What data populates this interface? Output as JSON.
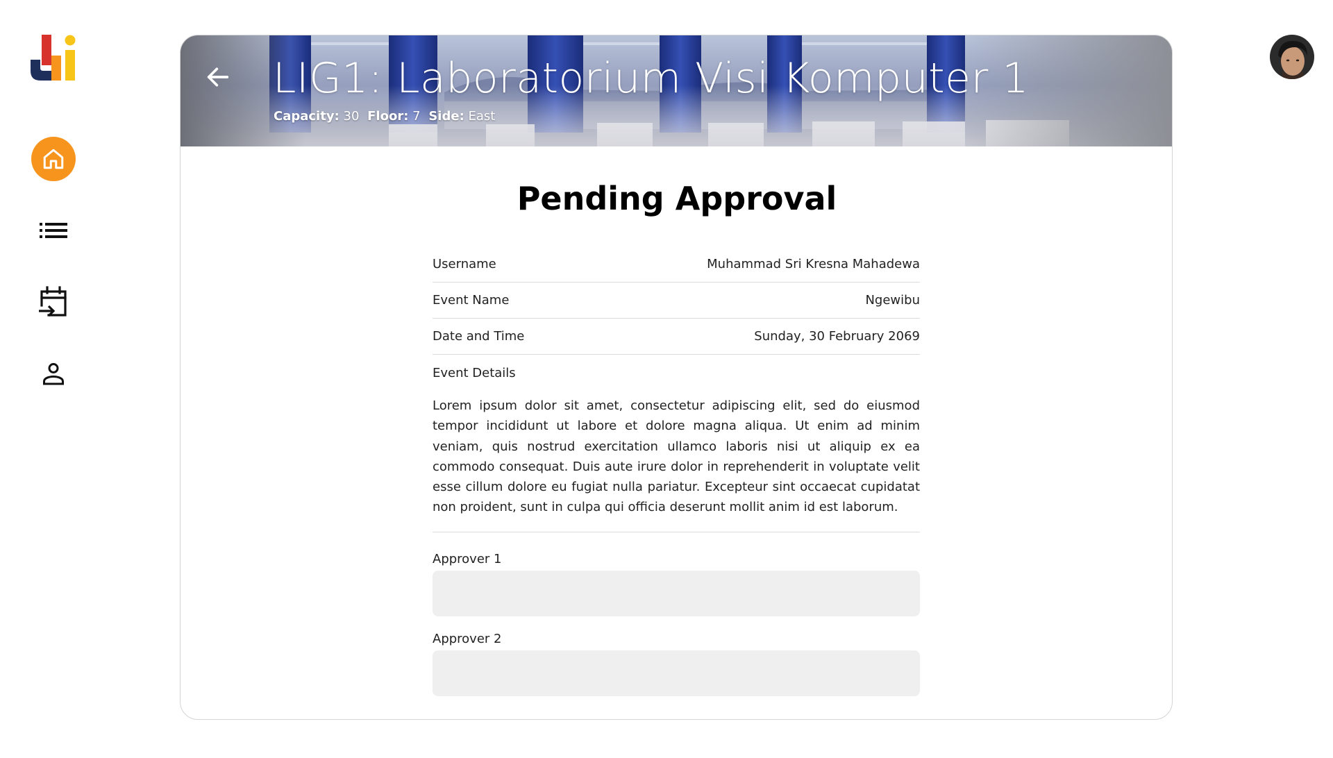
{
  "sidebar": {
    "logo_text": "Ji",
    "items": [
      {
        "name": "home",
        "icon": "home-icon",
        "active": true
      },
      {
        "name": "list",
        "icon": "list-icon",
        "active": false
      },
      {
        "name": "calendar-checkin",
        "icon": "calendar-arrow-icon",
        "active": false
      },
      {
        "name": "profile",
        "icon": "person-icon",
        "active": false
      }
    ]
  },
  "colors": {
    "accent": "#F7941D",
    "brand_blue": "#1F2F5C",
    "brand_red": "#D7322B",
    "brand_yellow": "#F7C518",
    "card_border": "#D4D4D4",
    "field_bg": "#EFEFEF"
  },
  "room": {
    "title": "LIG1: Laboratorium Visi Komputer 1",
    "capacity_label": "Capacity:",
    "capacity_value": "30",
    "floor_label": "Floor:",
    "floor_value": "7",
    "side_label": "Side:",
    "side_value": "East"
  },
  "page": {
    "heading": "Pending Approval"
  },
  "details": {
    "username_label": "Username",
    "username_value": "Muhammad Sri Kresna Mahadewa",
    "event_name_label": "Event Name",
    "event_name_value": "Ngewibu",
    "datetime_label": "Date and Time",
    "datetime_value": "Sunday, 30 February 2069",
    "event_details_label": "Event Details",
    "event_details_text": "Lorem ipsum dolor sit amet, consectetur adipiscing elit, sed do eiusmod tempor incididunt ut labore et dolore magna aliqua. Ut enim ad minim veniam, quis nostrud exercitation ullamco laboris nisi ut aliquip ex ea commodo consequat. Duis aute irure dolor in reprehenderit in voluptate velit esse cillum dolore eu fugiat nulla pariatur. Excepteur sint occaecat cupidatat non proident, sunt in culpa qui officia deserunt mollit anim id est laborum."
  },
  "approvers": [
    {
      "label": "Approver 1",
      "value": ""
    },
    {
      "label": "Approver 2",
      "value": ""
    }
  ]
}
